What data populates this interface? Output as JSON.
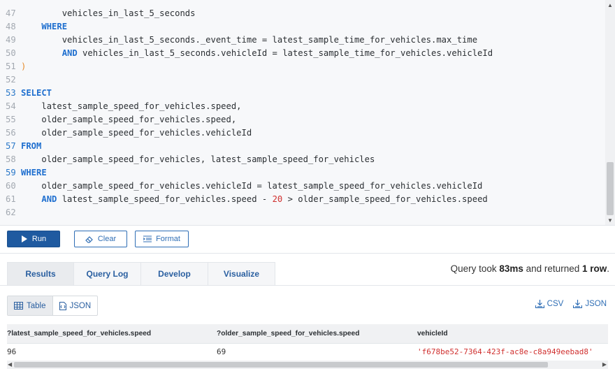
{
  "editor": {
    "lines": [
      {
        "n": "47",
        "indent": "        ",
        "parts": [
          {
            "t": "vehicles_in_last_5_seconds",
            "c": "txt"
          }
        ]
      },
      {
        "n": "48",
        "indent": "    ",
        "parts": [
          {
            "t": "WHERE",
            "c": "kw"
          }
        ]
      },
      {
        "n": "49",
        "indent": "        ",
        "parts": [
          {
            "t": "vehicles_in_last_5_seconds._event_time = latest_sample_time_for_vehicles.max_time",
            "c": "txt"
          }
        ]
      },
      {
        "n": "50",
        "indent": "        ",
        "parts": [
          {
            "t": "AND",
            "c": "kw"
          },
          {
            "t": " vehicles_in_last_5_seconds.vehicleId = latest_sample_time_for_vehicles.vehicleId",
            "c": "txt"
          }
        ]
      },
      {
        "n": "51",
        "indent": "",
        "parts": [
          {
            "t": ")",
            "c": "paren"
          }
        ]
      },
      {
        "n": "52",
        "indent": "",
        "parts": []
      },
      {
        "n": "53",
        "indent": "",
        "kwln": true,
        "parts": [
          {
            "t": "SELECT",
            "c": "kw"
          }
        ]
      },
      {
        "n": "54",
        "indent": "    ",
        "parts": [
          {
            "t": "latest_sample_speed_for_vehicles.speed,",
            "c": "txt"
          }
        ]
      },
      {
        "n": "55",
        "indent": "    ",
        "parts": [
          {
            "t": "older_sample_speed_for_vehicles.speed,",
            "c": "txt"
          }
        ]
      },
      {
        "n": "56",
        "indent": "    ",
        "parts": [
          {
            "t": "older_sample_speed_for_vehicles.vehicleId",
            "c": "txt"
          }
        ]
      },
      {
        "n": "57",
        "indent": "",
        "kwln": true,
        "parts": [
          {
            "t": "FROM",
            "c": "kw"
          }
        ]
      },
      {
        "n": "58",
        "indent": "    ",
        "parts": [
          {
            "t": "older_sample_speed_for_vehicles, latest_sample_speed_for_vehicles",
            "c": "txt"
          }
        ]
      },
      {
        "n": "59",
        "indent": "",
        "kwln": true,
        "parts": [
          {
            "t": "WHERE",
            "c": "kw"
          }
        ]
      },
      {
        "n": "60",
        "indent": "    ",
        "parts": [
          {
            "t": "older_sample_speed_for_vehicles.vehicleId = latest_sample_speed_for_vehicles.vehicleId",
            "c": "txt"
          }
        ]
      },
      {
        "n": "61",
        "indent": "    ",
        "parts": [
          {
            "t": "AND",
            "c": "kw"
          },
          {
            "t": " latest_sample_speed_for_vehicles.speed - ",
            "c": "txt"
          },
          {
            "t": "20",
            "c": "num"
          },
          {
            "t": " > older_sample_speed_for_vehicles.speed",
            "c": "txt"
          }
        ]
      },
      {
        "n": "62",
        "indent": "",
        "parts": []
      }
    ]
  },
  "toolbar": {
    "run_label": "Run",
    "clear_label": "Clear",
    "format_label": "Format"
  },
  "tabs": [
    {
      "label": "Results",
      "active": true
    },
    {
      "label": "Query Log",
      "active": false
    },
    {
      "label": "Develop",
      "active": false
    },
    {
      "label": "Visualize",
      "active": false
    }
  ],
  "summary": {
    "prefix": "Query took ",
    "duration": "83ms",
    "middle": " and returned ",
    "rows": "1 row",
    "suffix": "."
  },
  "view": {
    "table_label": "Table",
    "json_label": "JSON"
  },
  "downloads": {
    "csv_label": "CSV",
    "json_label": "JSON"
  },
  "results": {
    "columns": [
      "?latest_sample_speed_for_vehicles.speed",
      "?older_sample_speed_for_vehicles.speed",
      "vehicleId"
    ],
    "rows": [
      [
        "96",
        "69",
        "'f678be52-7364-423f-ac8e-c8a949eebad8'"
      ]
    ]
  },
  "colors": {
    "accent": "#1f5aa0",
    "keyword": "#1f6fcf",
    "string": "#d0302f"
  }
}
